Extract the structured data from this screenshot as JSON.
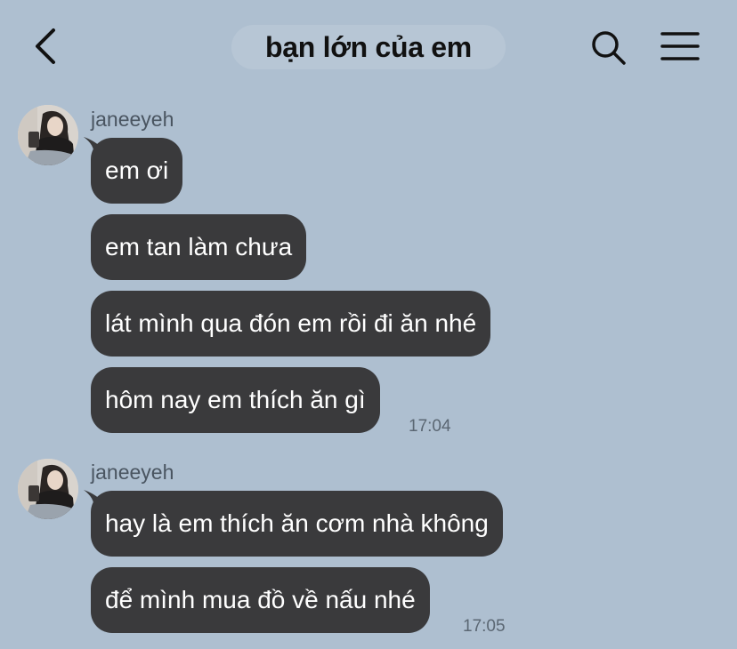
{
  "header": {
    "title": "bạn lớn của em",
    "back_icon": "chevron-left-icon",
    "search_icon": "search-icon",
    "menu_icon": "hamburger-menu-icon"
  },
  "colors": {
    "background": "#aebfd0",
    "bubble": "#3a3a3c",
    "bubble_text": "#ffffff"
  },
  "groups": [
    {
      "sender": "janeeyeh",
      "messages": [
        "em ơi",
        "em tan làm chưa",
        "lát mình qua đón em rồi đi ăn nhé",
        "hôm nay em thích ăn gì"
      ],
      "time": "17:04"
    },
    {
      "sender": "janeeyeh",
      "messages": [
        "hay là em thích ăn cơm nhà không",
        "để mình mua đồ về nấu nhé"
      ],
      "time": "17:05"
    }
  ]
}
